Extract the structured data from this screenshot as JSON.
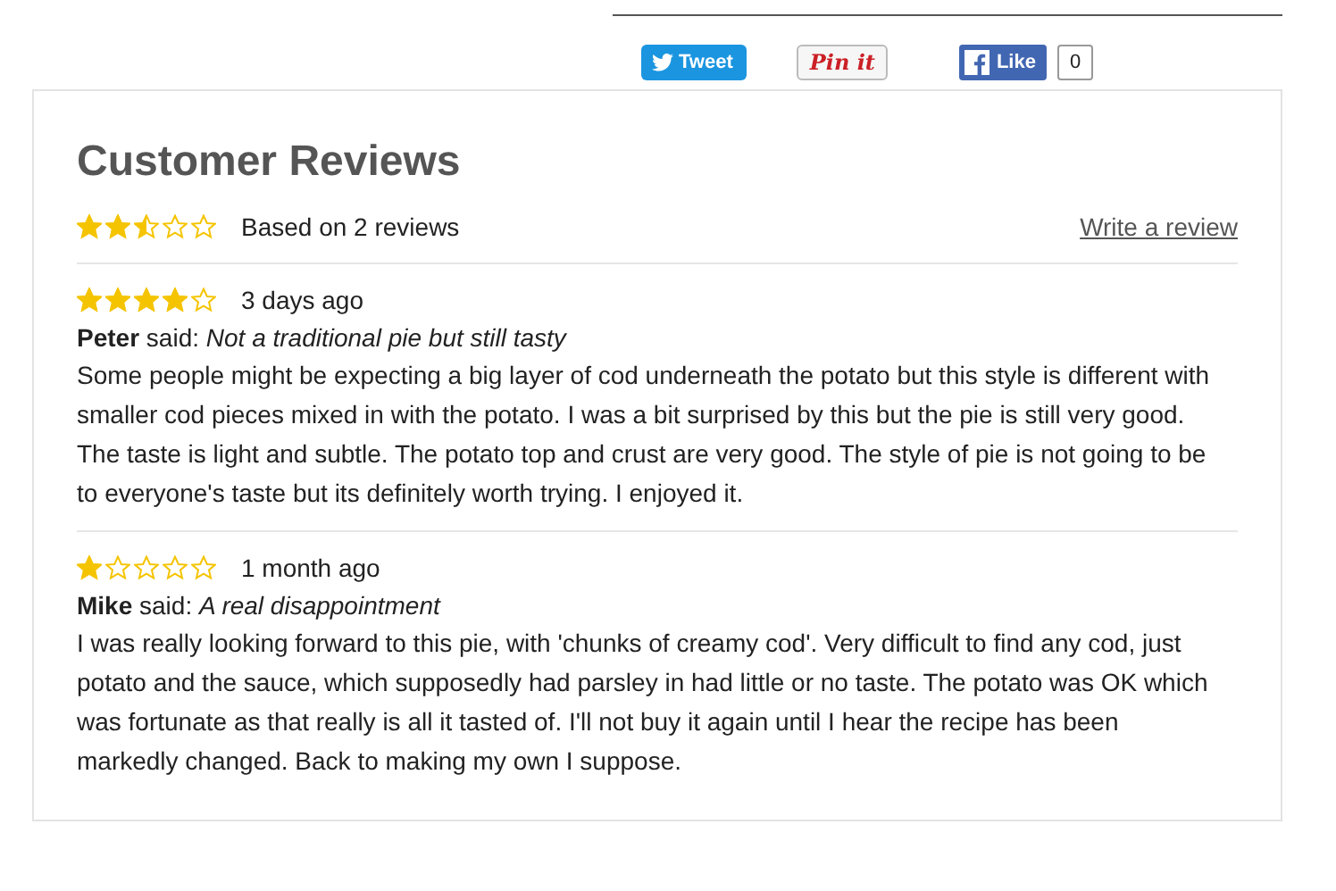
{
  "share": {
    "tweet": "Tweet",
    "pin": "Pin it",
    "like": "Like",
    "like_count": "0"
  },
  "reviews_panel": {
    "title": "Customer Reviews",
    "stars": 2.5,
    "summary": "Based on 2 reviews",
    "write_link": "Write a review",
    "reviews": [
      {
        "stars": 4,
        "date": "3 days ago",
        "byline": "**Peter** said: *Not a traditional pie but still tasty*",
        "body": "Some people might be expecting a big layer of cod underneath the potato but this style is different with smaller cod pieces mixed in with the potato. I was a bit surprised by this but the pie is still very good. The taste is light and subtle. The potato top and crust are very good. The style of pie is not going to be to everyone's taste but its definitely worth trying. I enjoyed it."
      },
      {
        "stars": 1,
        "date": "1 month ago",
        "byline": "**Mike** said: *A real disappointment*",
        "body": "I was really looking forward to this pie, with 'chunks of creamy cod'. Very difficult to find any cod, just potato and the sauce, which supposedly had parsley in had little or no taste. The potato was OK which was fortunate as that really is all it tasted of. I'll not buy it again until I hear the recipe has been markedly changed. Back to making my own I suppose."
      }
    ]
  }
}
